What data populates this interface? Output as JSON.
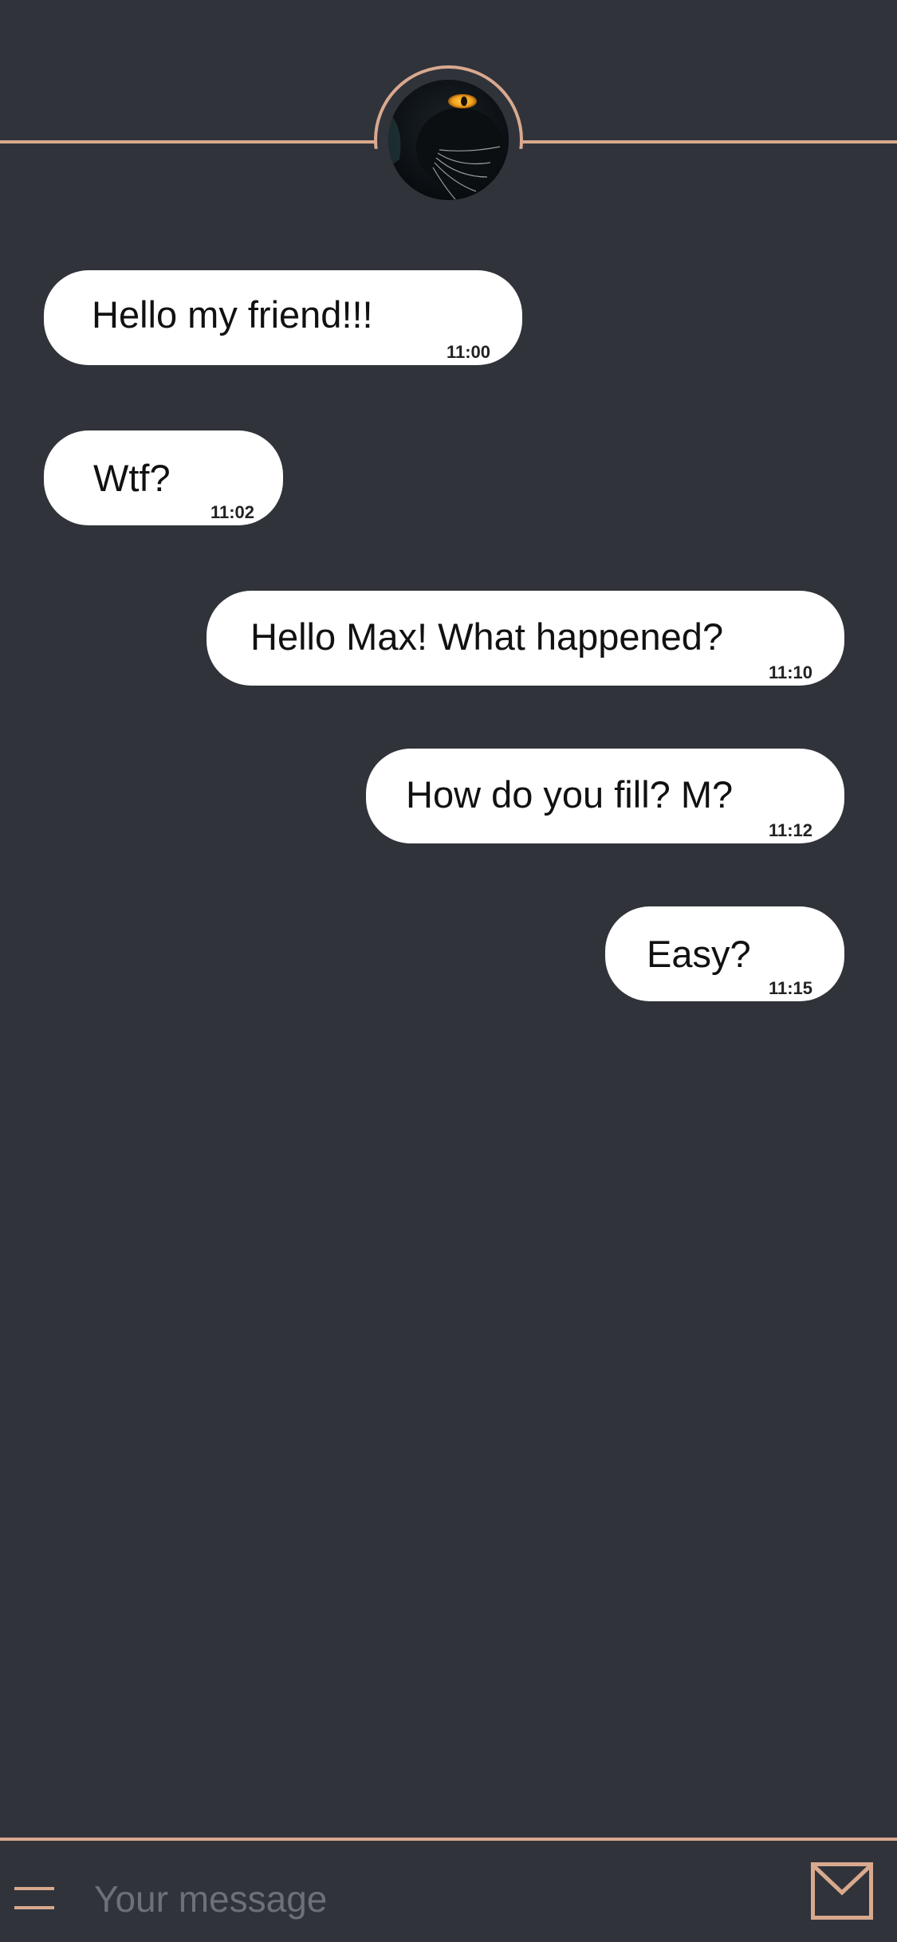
{
  "header": {
    "avatar_icon": "black-cat-avatar"
  },
  "messages": [
    {
      "text": "Hello my friend!!!",
      "time": "11:00",
      "side": "incoming"
    },
    {
      "text": "Wtf?",
      "time": "11:02",
      "side": "incoming"
    },
    {
      "text": "Hello Max! What happened?",
      "time": "11:10",
      "side": "outgoing"
    },
    {
      "text": "How do you fill? M?",
      "time": "11:12",
      "side": "outgoing"
    },
    {
      "text": "Easy?",
      "time": "11:15",
      "side": "outgoing"
    }
  ],
  "composer": {
    "placeholder": "Your message",
    "value": "",
    "menu_icon": "hamburger-menu-icon",
    "send_icon": "envelope-icon"
  },
  "colors": {
    "background": "#31333b",
    "accent": "#d9a98e",
    "bubble": "#ffffff",
    "cat_eye": "#f0a020"
  }
}
